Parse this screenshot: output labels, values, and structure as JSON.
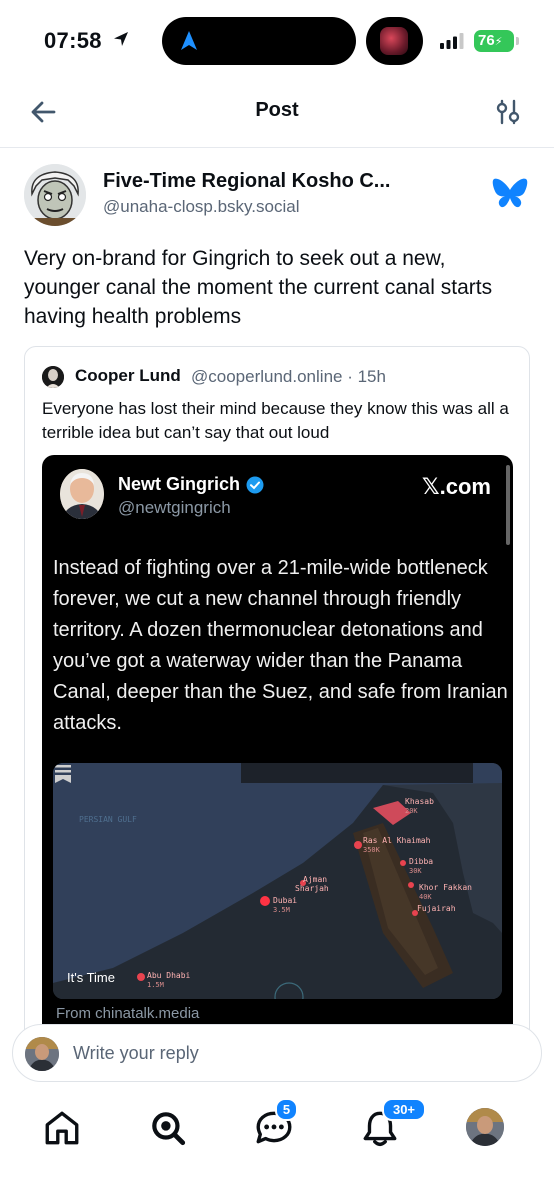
{
  "status_bar": {
    "time": "07:58",
    "battery": "76"
  },
  "header": {
    "title": "Post"
  },
  "post": {
    "author_name": "Five-Time Regional Kosho C...",
    "author_handle": "@unaha-closp.bsky.social",
    "text": "Very on-brand for Gingrich to seek out a new, younger canal the moment the current canal starts having health problems"
  },
  "quote": {
    "author_name": "Cooper Lund",
    "author_handle": "@cooperlund.online · 15h",
    "text": "Everyone has lost their mind because they know this was all a terrible idea but can’t say that out loud"
  },
  "embed": {
    "name": "Newt Gingrich",
    "handle": "@newtgingrich",
    "source": "𝕏.com",
    "text": "Instead of fighting over a 21-mile-wide bottleneck forever, we cut a new channel through friendly territory. A dozen thermonuclear detonations and you’ve got a waterway wider than the Panama Canal, deeper than the Suez, and safe from Iranian attacks.",
    "map": {
      "gulf_label": "PERSIAN GULF",
      "video_title": "It's Time",
      "cities": [
        {
          "name": "Khasab",
          "pop": "20K"
        },
        {
          "name": "Ras Al Khaimah",
          "pop": "350K"
        },
        {
          "name": "Dibba",
          "pop": "30K"
        },
        {
          "name": "Ajman",
          "pop": ""
        },
        {
          "name": "Sharjah",
          "pop": ""
        },
        {
          "name": "Khor Fakkan",
          "pop": "40K"
        },
        {
          "name": "Dubai",
          "pop": "3.5M"
        },
        {
          "name": "Fujairah",
          "pop": ""
        },
        {
          "name": "Abu Dhabi",
          "pop": "1.5M"
        }
      ]
    },
    "from": "From chinatalk.media"
  },
  "reply": {
    "placeholder": "Write your reply"
  },
  "nav": {
    "chat_badge": "5",
    "notif_badge": "30+"
  },
  "colors": {
    "accent": "#1083fe",
    "battery": "#34c759",
    "muted": "#5a6676"
  }
}
